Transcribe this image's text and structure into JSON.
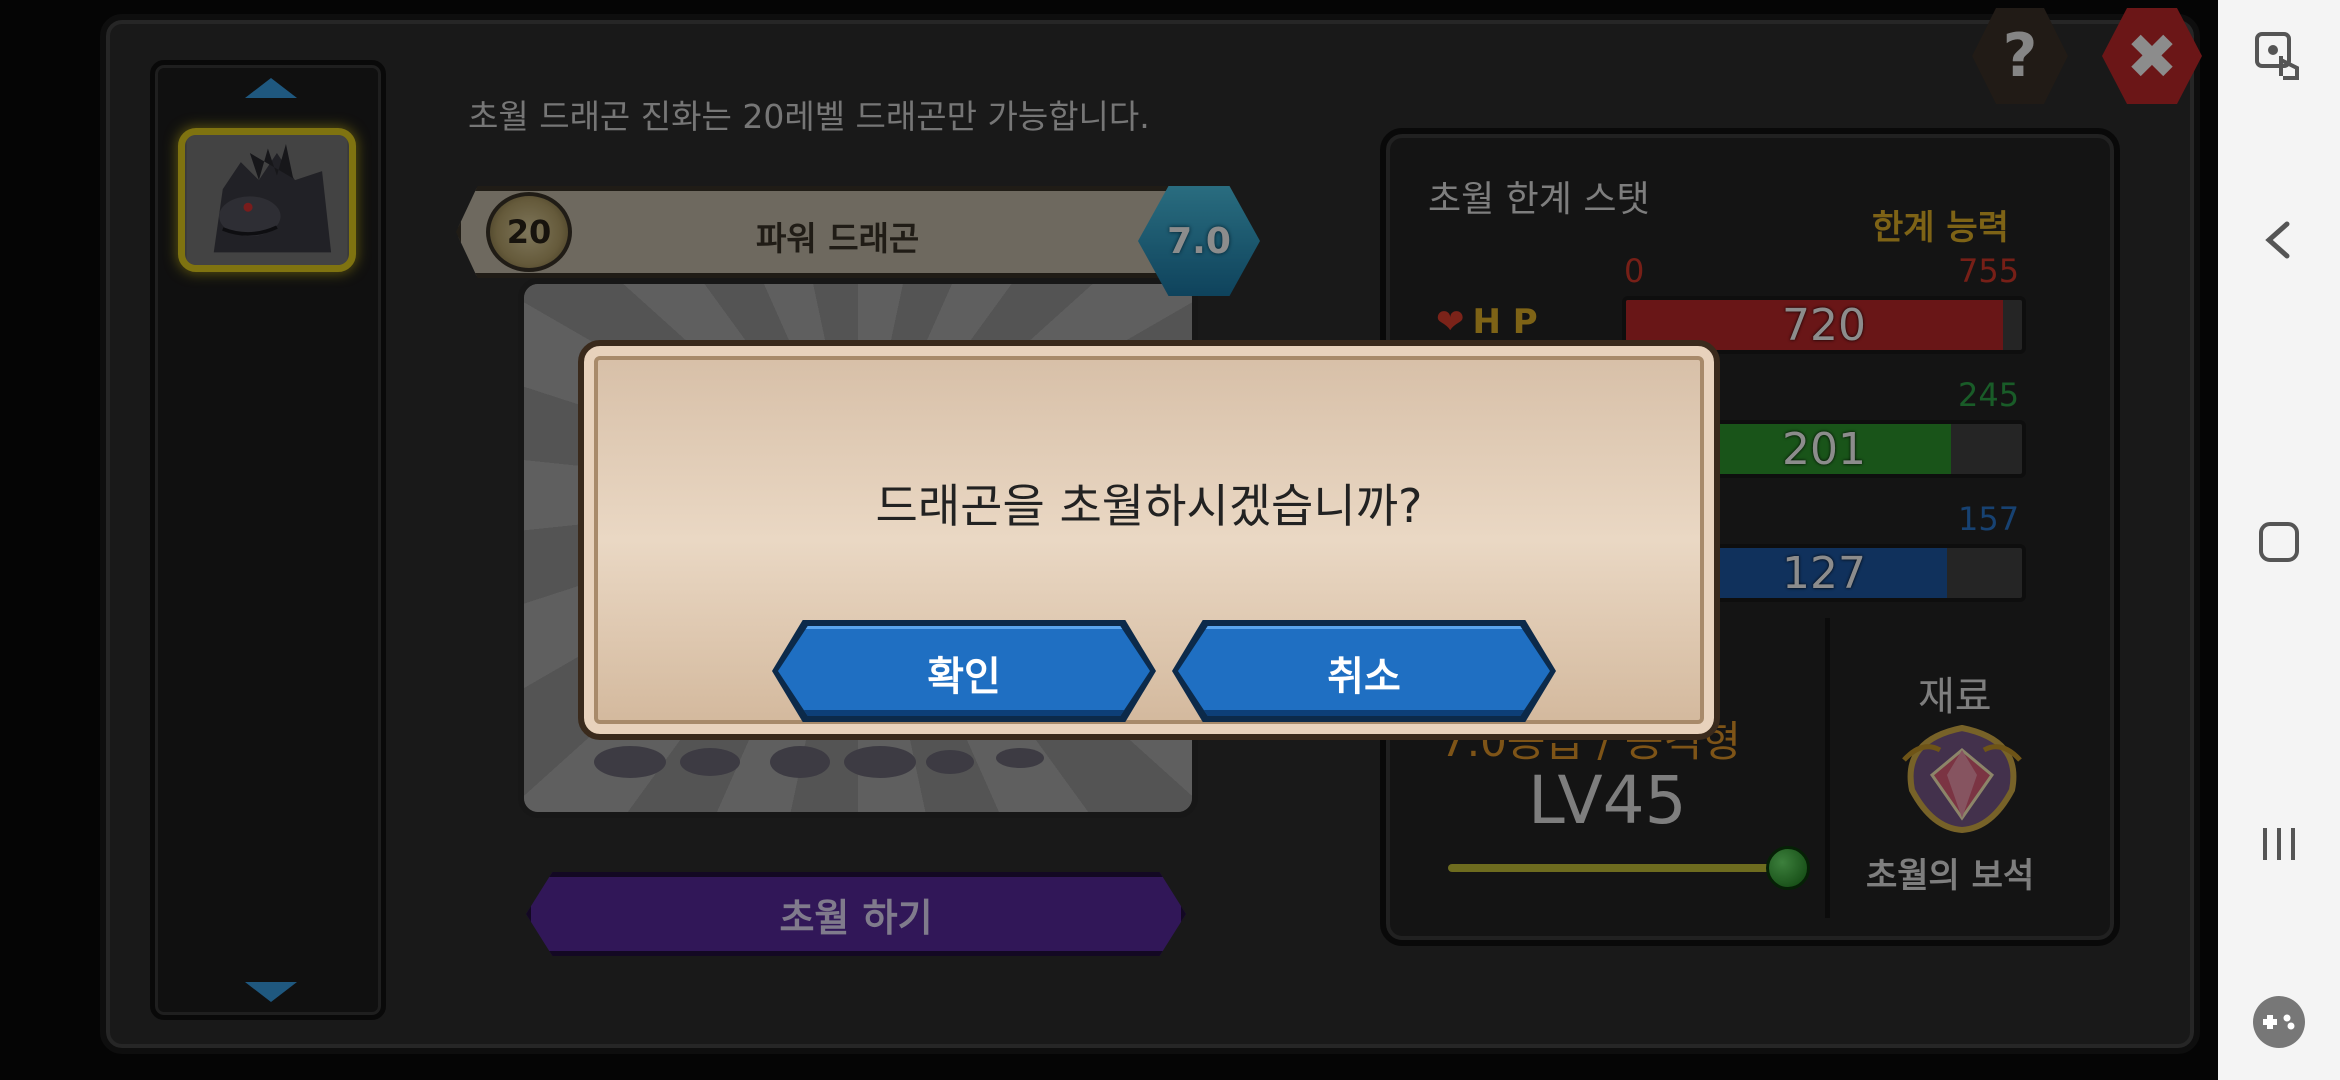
{
  "game": {
    "notice": "초월 드래곤 진화는 20레벨 드래곤만 가능합니다.",
    "dragon": {
      "level": "20",
      "name": "파워 드래곤",
      "grade": "7.0"
    },
    "evolve_button": "초월 하기",
    "help_button": "?",
    "close_button": "✖",
    "stats": {
      "title": "초월 한계 스탯",
      "limit_label": "한계 능력",
      "hp_label": "H P",
      "hp_min": "0",
      "hp_max": "755",
      "hp_value": "720",
      "hp_fill": 0.953,
      "atk_max": "245",
      "atk_value": "201",
      "atk_fill": 0.82,
      "def_max": "157",
      "def_value": "127",
      "def_fill": 0.81
    },
    "type_text": "7.0등급 / 공격형",
    "level_text": "LV45",
    "level_progress": 1.0,
    "material_title": "재료",
    "material_name": "초월의 보석",
    "colors": {
      "hp": "#c0282a",
      "atk": "#2e9a2e",
      "def": "#1e5aa8",
      "limit": "#e6b529",
      "hp_max": "#d93a2a",
      "atk_max": "#2ea84a",
      "def_max": "#2a78d0"
    }
  },
  "dialog": {
    "message": "드래곤을 초월하시겠습니까?",
    "confirm": "확인",
    "cancel": "취소"
  },
  "navbar": {
    "icons": [
      "game-touch-icon",
      "back-icon",
      "home-icon",
      "recents-icon",
      "game-tools-icon"
    ]
  }
}
